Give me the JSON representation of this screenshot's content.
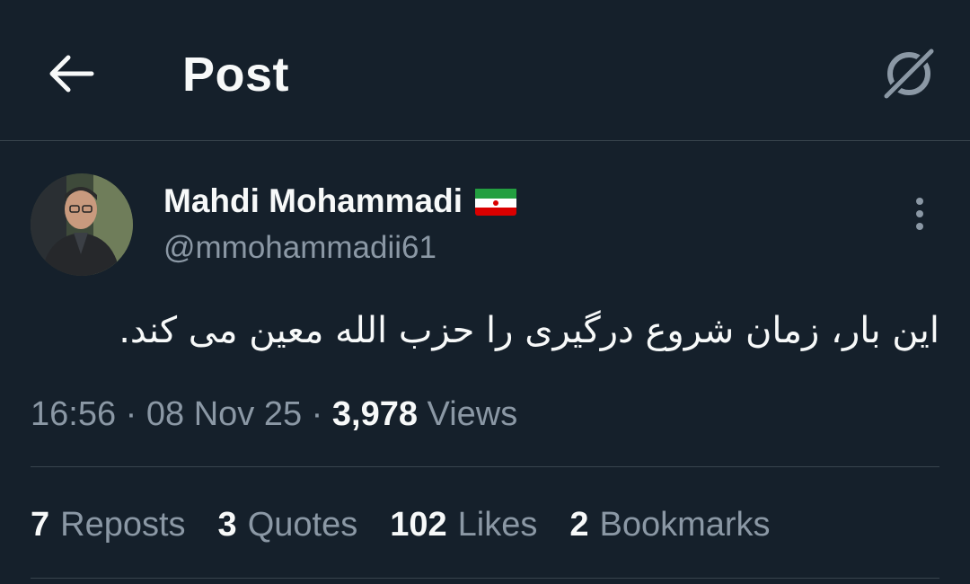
{
  "header": {
    "title": "Post",
    "back_icon": "arrow-left-icon",
    "grok_icon": "grok-icon"
  },
  "author": {
    "name": "Mahdi Mohammadi",
    "handle": "@mmohammadii61",
    "flag": "iran-flag-emoji"
  },
  "tweet": {
    "text": "این بار، زمان شروع درگیری را حزب الله معین می کند.",
    "time": "16:56",
    "date": "08 Nov 25",
    "separator": "·",
    "views_count": "3,978",
    "views_label": "Views"
  },
  "stats": [
    {
      "count": "7",
      "label": "Reposts"
    },
    {
      "count": "3",
      "label": "Quotes"
    },
    {
      "count": "102",
      "label": "Likes"
    },
    {
      "count": "2",
      "label": "Bookmarks"
    }
  ],
  "colors": {
    "background": "#15202b",
    "text_primary": "#f7f9f9",
    "text_secondary": "#8b98a5",
    "border": "#38444d"
  }
}
